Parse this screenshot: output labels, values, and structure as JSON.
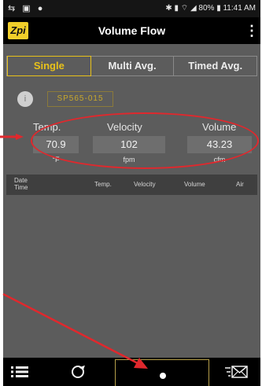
{
  "status_bar": {
    "left_icons": "⇆ ▣ ●",
    "right_text": "✱ ▮ ⌔ ◢ 80% ▮ 11:41 AM"
  },
  "app_bar": {
    "logo": "Zpi",
    "title": "Volume Flow",
    "menu_icon": "overflow-menu-icon"
  },
  "tabs": [
    {
      "label": "Single",
      "active": true
    },
    {
      "label": "Multi Avg.",
      "active": false
    },
    {
      "label": "Timed Avg.",
      "active": false
    }
  ],
  "probe": {
    "dot_label": "i",
    "id": "SP565-015"
  },
  "measurements": [
    {
      "label": "Temp.",
      "value": "70.9",
      "unit": "°F"
    },
    {
      "label": "Velocity",
      "value": "102",
      "unit": "fpm"
    },
    {
      "label": "Volume",
      "value": "43.23",
      "unit": "cfm"
    }
  ],
  "table_header": {
    "date_line1": "Date",
    "date_line2": "Time",
    "temp": "Temp.",
    "velocity": "Velocity",
    "volume": "Volume",
    "air": "Air"
  },
  "annotation_color": "#e0282d",
  "accent_color": "#e8c11a",
  "bottom_bar": {
    "icons": [
      "list-icon",
      "refresh-icon",
      "record-button",
      "email-icon"
    ]
  }
}
